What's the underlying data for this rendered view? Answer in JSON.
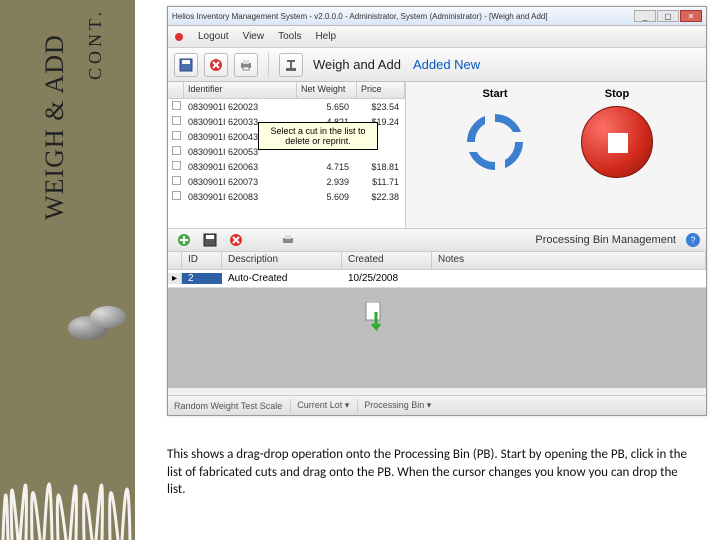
{
  "slide": {
    "titleMain": "WEIGH & ADD",
    "titleCont": "CONT."
  },
  "window": {
    "title": "Helios Inventory Management System - v2.0.0.0 - Administrator, System (Administrator) - [Weigh and Add]"
  },
  "menu": {
    "logout": "Logout",
    "view": "View",
    "tools": "Tools",
    "help": "Help"
  },
  "toolbar": {
    "weighAdd": "Weigh and Add",
    "addedNew": "Added New"
  },
  "cuts": {
    "headers": {
      "identifier": "Identifier",
      "netWeight": "Net Weight",
      "price": "Price"
    },
    "rows": [
      {
        "id": "0830901I 620023",
        "nw": "5.650",
        "pr": "$23.54"
      },
      {
        "id": "0830901I 620033",
        "nw": "4.821",
        "pr": "$19.24"
      },
      {
        "id": "0830901I 620043",
        "nw": "",
        "pr": ""
      },
      {
        "id": "0830901I 620053",
        "nw": "",
        "pr": ""
      },
      {
        "id": "0830901I 620063",
        "nw": "4.715",
        "pr": "$18.81"
      },
      {
        "id": "0830901I 620073",
        "nw": "2.939",
        "pr": "$11.71"
      },
      {
        "id": "0830901I 620083",
        "nw": "5.609",
        "pr": "$22.38"
      }
    ],
    "tooltip": "Select a cut in the list to delete or reprint."
  },
  "startstop": {
    "start": "Start",
    "stop": "Stop"
  },
  "pbm": {
    "label": "Processing Bin Management"
  },
  "grid": {
    "headers": {
      "id": "ID",
      "desc": "Description",
      "created": "Created",
      "notes": "Notes"
    },
    "row": {
      "id": "2",
      "desc": "Auto-Created",
      "created": "10/25/2008"
    }
  },
  "status": {
    "left": "Random Weight Test Scale",
    "mid": "Current Lot  ▾",
    "right": "Processing Bin  ▾"
  },
  "caption": "This shows a drag-drop operation onto the Processing Bin (PB). Start by opening the PB, click in the list of fabricated cuts and drag onto the PB. When the cursor changes you know you can drop the list."
}
